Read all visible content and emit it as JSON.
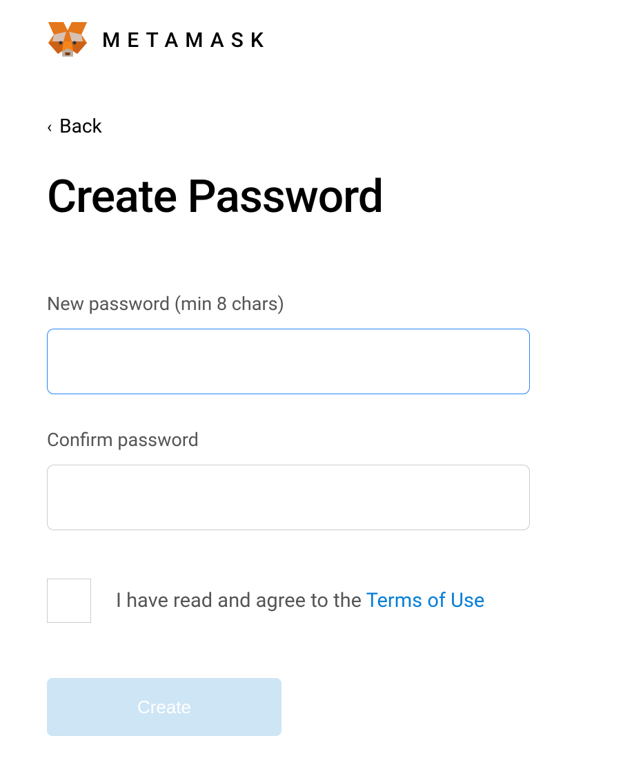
{
  "header": {
    "brand_name": "METAMASK"
  },
  "navigation": {
    "back_label": "Back"
  },
  "page": {
    "title": "Create Password"
  },
  "form": {
    "new_password": {
      "label": "New password (min 8 chars)",
      "value": ""
    },
    "confirm_password": {
      "label": "Confirm password",
      "value": ""
    },
    "terms": {
      "text": "I have read and agree to the ",
      "link_text": "Terms of Use",
      "checked": false
    },
    "submit_label": "Create"
  }
}
